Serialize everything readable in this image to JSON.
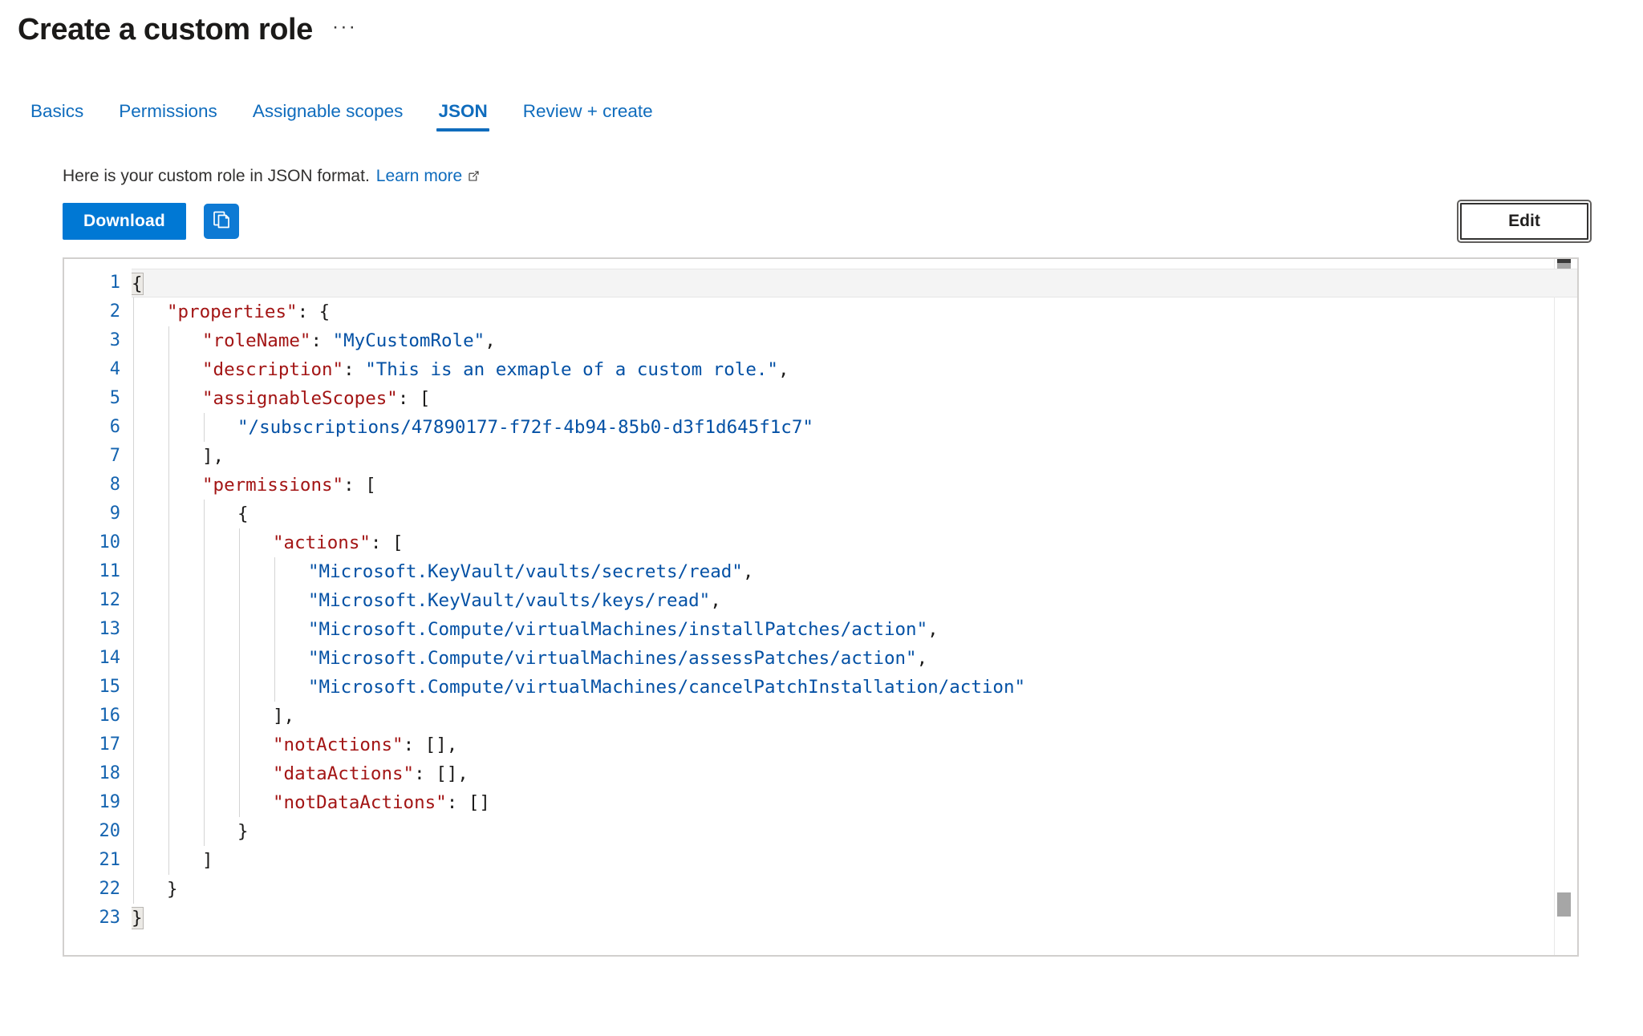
{
  "header": {
    "title": "Create a custom role",
    "more_label": "···"
  },
  "tabs": [
    {
      "label": "Basics",
      "active": false
    },
    {
      "label": "Permissions",
      "active": false
    },
    {
      "label": "Assignable scopes",
      "active": false
    },
    {
      "label": "JSON",
      "active": true
    },
    {
      "label": "Review + create",
      "active": false
    }
  ],
  "description": {
    "text": "Here is your custom role in JSON format.",
    "link_label": "Learn more",
    "link_icon": "external-link-icon"
  },
  "commandbar": {
    "download_label": "Download",
    "copy_icon": "copy-icon",
    "edit_label": "Edit",
    "accent_color": "#0078d4",
    "edit_border_color": "#323130"
  },
  "editor": {
    "language": "json",
    "line_count": 23,
    "current_line": 1,
    "line_numbers": [
      1,
      2,
      3,
      4,
      5,
      6,
      7,
      8,
      9,
      10,
      11,
      12,
      13,
      14,
      15,
      16,
      17,
      18,
      19,
      20,
      21,
      22,
      23
    ],
    "colors": {
      "key": "#a31515",
      "string": "#0451a5",
      "punctuation": "#1b1a19",
      "line_number": "#1564b0",
      "border": "#d2d0ce"
    },
    "lines": [
      {
        "n": 1,
        "indent": 0,
        "text": "{"
      },
      {
        "n": 2,
        "indent": 1,
        "text": "\"properties\": {"
      },
      {
        "n": 3,
        "indent": 2,
        "text": "\"roleName\": \"MyCustomRole\","
      },
      {
        "n": 4,
        "indent": 2,
        "text": "\"description\": \"This is an exmaple of a custom role.\","
      },
      {
        "n": 5,
        "indent": 2,
        "text": "\"assignableScopes\": ["
      },
      {
        "n": 6,
        "indent": 3,
        "text": "\"/subscriptions/47890177-f72f-4b94-85b0-d3f1d645f1c7\""
      },
      {
        "n": 7,
        "indent": 2,
        "text": "],"
      },
      {
        "n": 8,
        "indent": 2,
        "text": "\"permissions\": ["
      },
      {
        "n": 9,
        "indent": 3,
        "text": "{"
      },
      {
        "n": 10,
        "indent": 4,
        "text": "\"actions\": ["
      },
      {
        "n": 11,
        "indent": 5,
        "text": "\"Microsoft.KeyVault/vaults/secrets/read\","
      },
      {
        "n": 12,
        "indent": 5,
        "text": "\"Microsoft.KeyVault/vaults/keys/read\","
      },
      {
        "n": 13,
        "indent": 5,
        "text": "\"Microsoft.Compute/virtualMachines/installPatches/action\","
      },
      {
        "n": 14,
        "indent": 5,
        "text": "\"Microsoft.Compute/virtualMachines/assessPatches/action\","
      },
      {
        "n": 15,
        "indent": 5,
        "text": "\"Microsoft.Compute/virtualMachines/cancelPatchInstallation/action\""
      },
      {
        "n": 16,
        "indent": 4,
        "text": "],"
      },
      {
        "n": 17,
        "indent": 4,
        "text": "\"notActions\": [],"
      },
      {
        "n": 18,
        "indent": 4,
        "text": "\"dataActions\": [],"
      },
      {
        "n": 19,
        "indent": 4,
        "text": "\"notDataActions\": []"
      },
      {
        "n": 20,
        "indent": 3,
        "text": "}"
      },
      {
        "n": 21,
        "indent": 2,
        "text": "]"
      },
      {
        "n": 22,
        "indent": 1,
        "text": "}"
      },
      {
        "n": 23,
        "indent": 0,
        "text": "}"
      }
    ],
    "json_value": {
      "properties": {
        "roleName": "MyCustomRole",
        "description": "This is an exmaple of a custom role.",
        "assignableScopes": [
          "/subscriptions/47890177-f72f-4b94-85b0-d3f1d645f1c7"
        ],
        "permissions": [
          {
            "actions": [
              "Microsoft.KeyVault/vaults/secrets/read",
              "Microsoft.KeyVault/vaults/keys/read",
              "Microsoft.Compute/virtualMachines/installPatches/action",
              "Microsoft.Compute/virtualMachines/assessPatches/action",
              "Microsoft.Compute/virtualMachines/cancelPatchInstallation/action"
            ],
            "notActions": [],
            "dataActions": [],
            "notDataActions": []
          }
        ]
      }
    }
  }
}
